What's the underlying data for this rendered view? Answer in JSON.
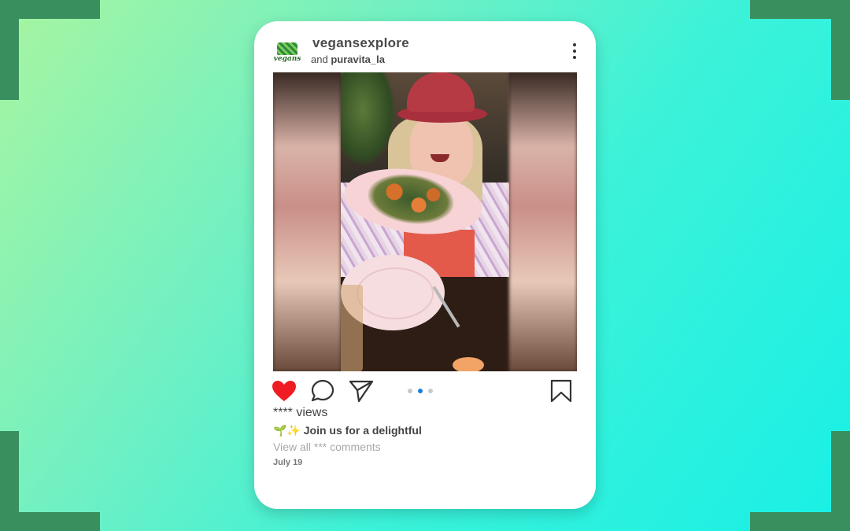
{
  "post": {
    "username": "vegansexplore",
    "collab_prefix": "and",
    "collab_user": "puravita_la",
    "avatar_text": "vegans",
    "views": "**** views",
    "caption": "🌱✨ Join us for a delightful",
    "comments_link": "View all *** comments",
    "date": "July 19"
  },
  "carousel": {
    "total": 3,
    "active_index": 1
  },
  "icons": {
    "like": "heart-icon",
    "comment": "comment-icon",
    "share": "send-icon",
    "save": "bookmark-icon",
    "menu": "more-vertical-icon"
  },
  "colors": {
    "like_active": "#ef1c24",
    "carousel_active": "#1a7fd6",
    "corner_brackets": "#3a8f5e"
  }
}
